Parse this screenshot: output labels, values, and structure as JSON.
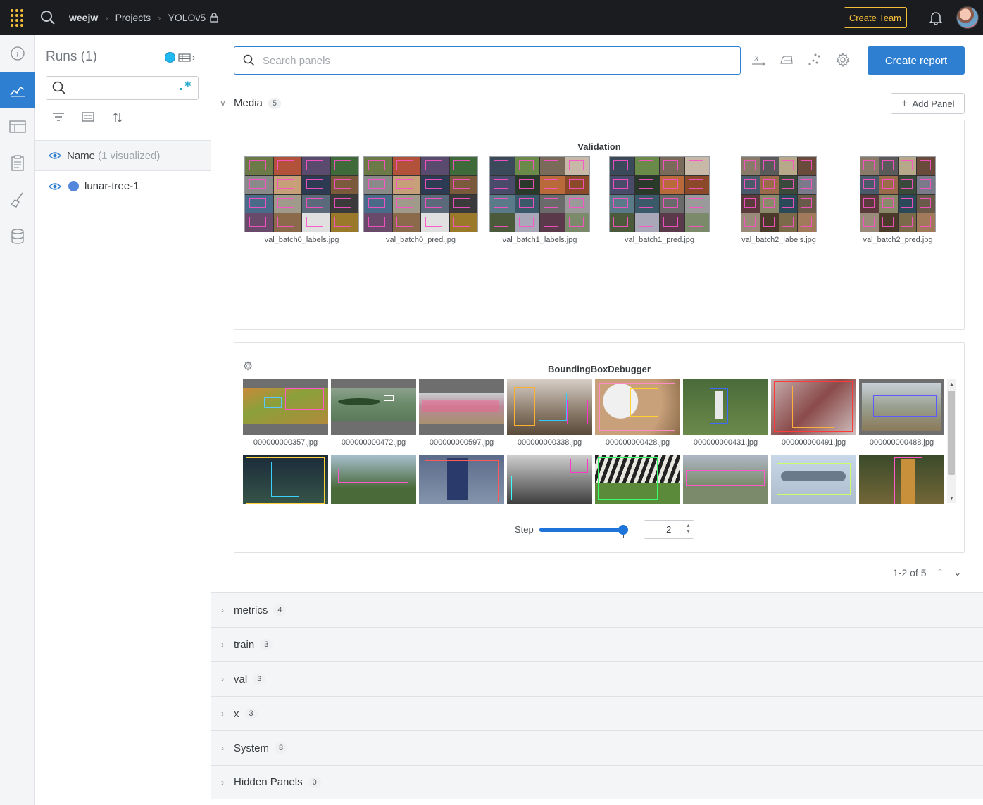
{
  "topbar": {
    "breadcrumbs": [
      "weejw",
      "Projects",
      "YOLOv5"
    ],
    "create_team_label": "Create Team",
    "icons": [
      "wandb-logo-icon",
      "search-icon",
      "lock-icon",
      "bell-icon",
      "avatar"
    ]
  },
  "rail": {
    "items": [
      {
        "name": "info-icon",
        "active": false
      },
      {
        "name": "charts-icon",
        "active": true
      },
      {
        "name": "table-icon",
        "active": false
      },
      {
        "name": "reports-icon",
        "active": false
      },
      {
        "name": "sweeps-broom-icon",
        "active": false
      },
      {
        "name": "artifacts-database-icon",
        "active": false
      }
    ]
  },
  "runs": {
    "title": "Runs (1)",
    "search_value": "",
    "regex_label": ".*",
    "column_name": "Name",
    "visualized": "(1 visualized)",
    "items": [
      {
        "name": "lunar-tree-1",
        "color": "#5387dd"
      }
    ]
  },
  "toolbar": {
    "search_placeholder": "Search panels",
    "create_report_label": "Create report"
  },
  "media": {
    "title": "Media",
    "count": "5",
    "add_panel_label": "Add Panel",
    "validation": {
      "title": "Validation",
      "images": [
        "val_batch0_labels.jpg",
        "val_batch0_pred.jpg",
        "val_batch1_labels.jpg",
        "val_batch1_pred.jpg",
        "val_batch2_labels.jpg",
        "val_batch2_pred.jpg"
      ]
    },
    "bbox_debugger": {
      "title": "BoundingBoxDebugger",
      "row1": [
        "000000000357.jpg",
        "000000000472.jpg",
        "000000000597.jpg",
        "000000000338.jpg",
        "000000000428.jpg",
        "000000000431.jpg",
        "000000000491.jpg",
        "000000000488.jpg"
      ],
      "step_label": "Step",
      "step_value": "2",
      "step_fraction": 1.0
    },
    "pager": "1-2 of 5"
  },
  "sections": [
    {
      "title": "metrics",
      "count": "4"
    },
    {
      "title": "train",
      "count": "3"
    },
    {
      "title": "val",
      "count": "3"
    },
    {
      "title": "x",
      "count": "3"
    },
    {
      "title": "System",
      "count": "8"
    },
    {
      "title": "Hidden Panels",
      "count": "0"
    }
  ],
  "colors": {
    "accent": "#2e7fd1",
    "topbar_bg": "#1a1c1f",
    "brand_yellow": "#f4bd3a",
    "run_color": "#5387dd"
  }
}
